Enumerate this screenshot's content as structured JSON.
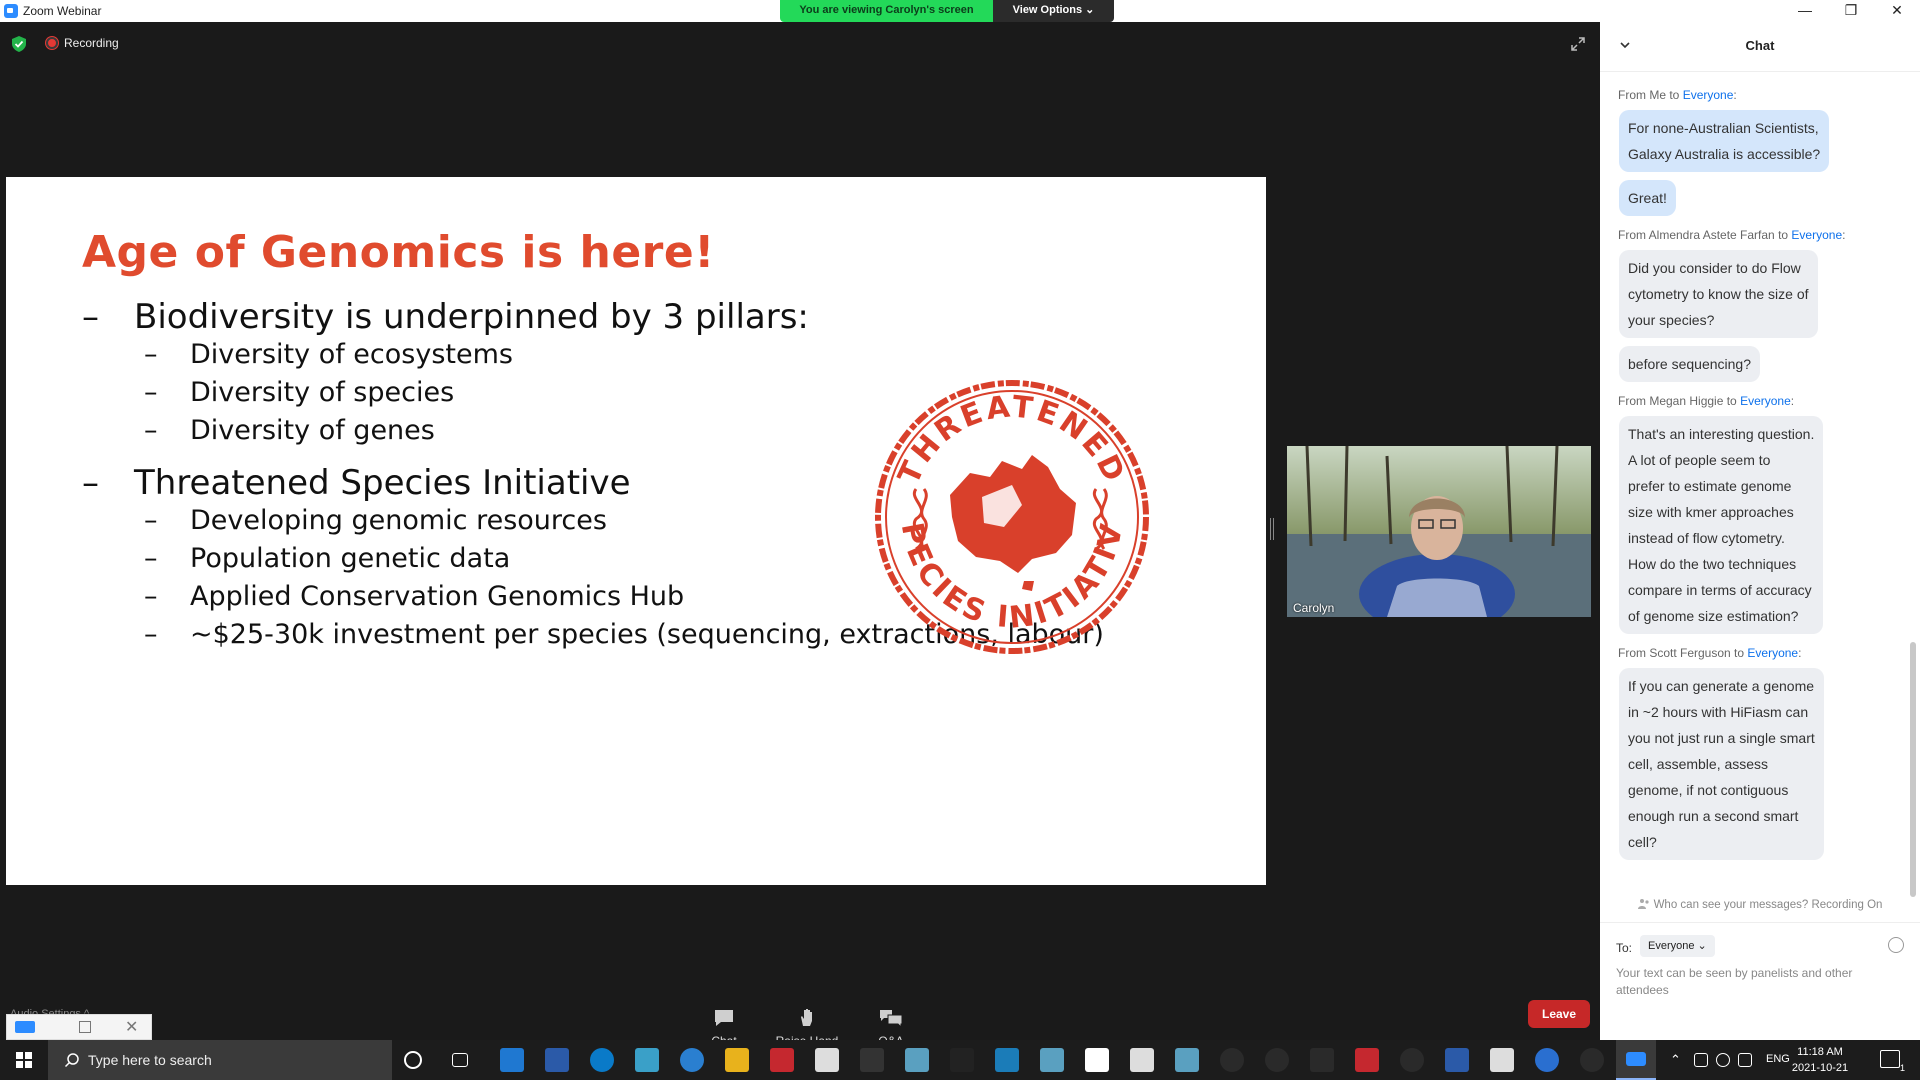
{
  "window": {
    "app_title": "Zoom Webinar",
    "viewing_banner": "You are viewing Carolyn's screen",
    "view_options": "View Options ⌄",
    "minimize": "—",
    "restore": "❐",
    "close": "✕"
  },
  "meeting": {
    "recording_label": "Recording",
    "participant_name": "Carolyn",
    "audio_settings": "Audio Settings ^"
  },
  "slide": {
    "title": "Age of Genomics is here!",
    "bullets": [
      {
        "level": 1,
        "text": "Biodiversity is underpinned by 3 pillars:"
      },
      {
        "level": 2,
        "text": "Diversity of ecosystems"
      },
      {
        "level": 2,
        "text": "Diversity of species"
      },
      {
        "level": 2,
        "text": "Diversity of genes"
      },
      {
        "level": 1,
        "text": "Threatened Species Initiative"
      },
      {
        "level": 2,
        "text": "Developing genomic resources"
      },
      {
        "level": 2,
        "text": "Population genetic data"
      },
      {
        "level": 2,
        "text": "Applied Conservation Genomics Hub"
      },
      {
        "level": 2,
        "text": "~$25-30k investment per species (sequencing, extractions, labour)"
      }
    ],
    "dash": "–",
    "logo_text_top": "THREATENED",
    "logo_text_bottom": "SPECIES INITIATIVE",
    "logo_color": "#d9402b"
  },
  "toolbar": {
    "chat": "Chat",
    "raise_hand": "Raise Hand",
    "qa": "Q&A",
    "leave": "Leave"
  },
  "chat": {
    "title": "Chat",
    "messages": [
      {
        "from": "From Me to ",
        "to": "Everyone",
        "suffix": ":",
        "lines": [
          [
            "For none-Australian Scientists,",
            "Galaxy Australia is accessible?"
          ],
          [
            "Great!"
          ]
        ],
        "me": true
      },
      {
        "from": "From Almendra Astete Farfan to ",
        "to": "Everyone",
        "suffix": ":",
        "lines": [
          [
            "Did you consider to do Flow",
            "cytometry to know the size of",
            "your species?"
          ],
          [
            "before sequencing?"
          ]
        ],
        "me": false
      },
      {
        "from": "From Megan Higgie to ",
        "to": "Everyone",
        "suffix": ":",
        "lines": [
          [
            "That's an interesting question.",
            "A lot of people seem to",
            "prefer to estimate genome",
            "size with kmer approaches",
            "instead of flow cytometry.",
            "How do the two techniques",
            "compare in terms of accuracy",
            "of genome size estimation?"
          ]
        ],
        "me": false
      },
      {
        "from": "From Scott Ferguson to ",
        "to": "Everyone",
        "suffix": ":",
        "lines": [
          [
            "If you can generate a genome",
            "in ~2 hours with HiFiasm can",
            "you not just run a single smart",
            "cell, assemble, assess",
            "genome, if not contiguous",
            "enough run a second smart",
            "cell?"
          ]
        ],
        "me": false
      }
    ],
    "privacy_note": "Who can see your messages? Recording On",
    "to_label": "To:",
    "recipient": "Everyone ⌄",
    "input_placeholder": "Your text can be seen by panelists and other attendees"
  },
  "taskbar": {
    "search_placeholder": "Type here to search",
    "language": "ENG",
    "time": "11:18 AM",
    "date": "2021-10-21",
    "notification_count": "1"
  },
  "colors": {
    "accent_red": "#e04b2e",
    "zoom_blue": "#0e71eb",
    "banner_green": "#23d959",
    "leave_red": "#c62828"
  }
}
